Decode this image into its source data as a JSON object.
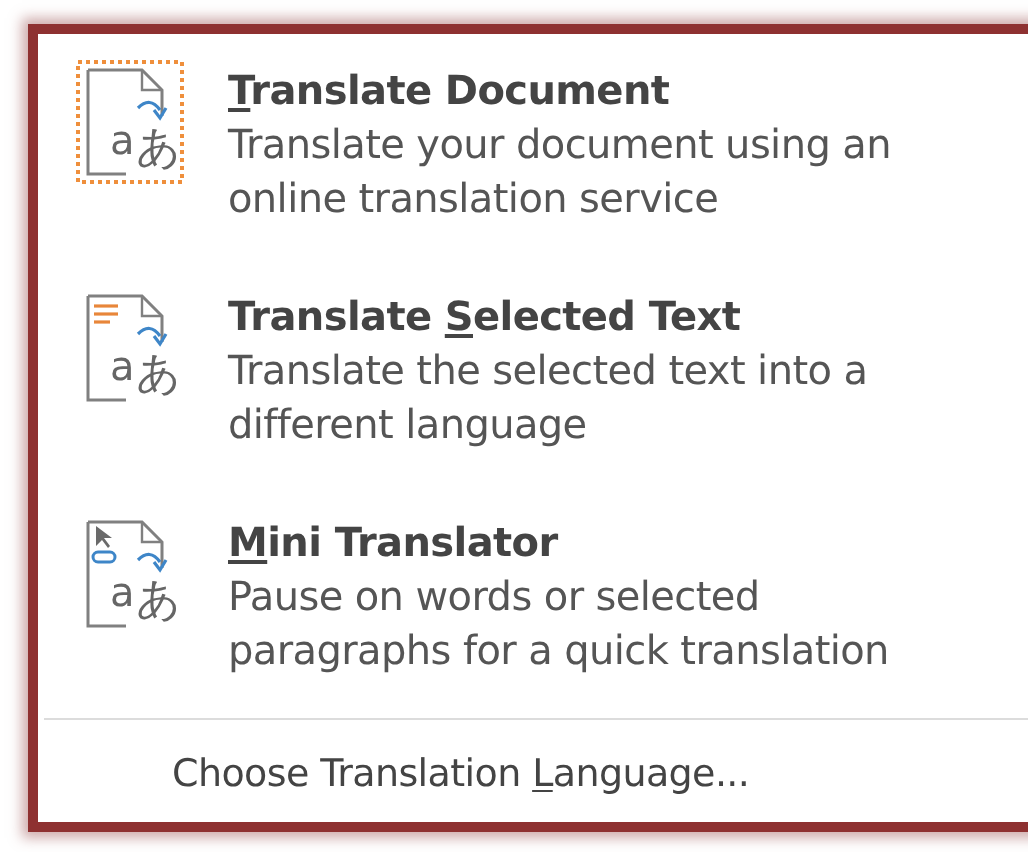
{
  "items": [
    {
      "kind": "document",
      "selected": true,
      "title": {
        "key": "T",
        "after": "ranslate Document"
      },
      "description": "Translate your document using an online translation service",
      "glyphs": [
        "a",
        "あ"
      ]
    },
    {
      "kind": "selection",
      "selected": false,
      "title": {
        "before": "Translate ",
        "key": "S",
        "after": "elected Text"
      },
      "description": "Translate the selected text into a different language",
      "glyphs": [
        "a",
        "あ"
      ]
    },
    {
      "kind": "mini",
      "selected": false,
      "title": {
        "key": "M",
        "after": "ini Translator"
      },
      "description": "Pause on words or selected paragraphs for a quick translation",
      "glyphs": [
        "a",
        "あ"
      ]
    }
  ],
  "footer": {
    "before": "Choose Translation ",
    "key": "L",
    "after": "anguage..."
  }
}
